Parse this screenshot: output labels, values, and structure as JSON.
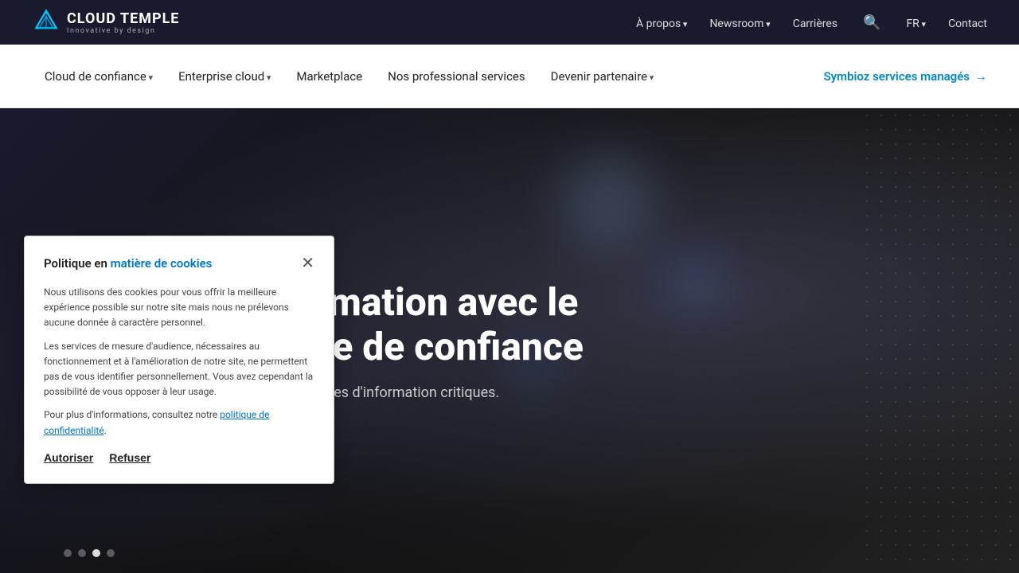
{
  "topnav": {
    "logo_text": "CLOUD TEMPLE",
    "logo_sub": "Innovative by design",
    "links": [
      {
        "label": "À propos",
        "has_arrow": true
      },
      {
        "label": "Newsroom",
        "has_arrow": true
      },
      {
        "label": "Carrières",
        "has_arrow": false
      },
      {
        "label": "FR",
        "has_arrow": true
      },
      {
        "label": "Contact",
        "has_arrow": false
      }
    ]
  },
  "secnav": {
    "links": [
      {
        "label": "Cloud de confiance",
        "has_arrow": true
      },
      {
        "label": "Enterprise cloud",
        "has_arrow": true
      },
      {
        "label": "Marketplace",
        "has_arrow": false
      },
      {
        "label": "Nos professional services",
        "has_arrow": false
      },
      {
        "label": "Devenir partenaire",
        "has_arrow": true
      }
    ],
    "cta_label": "Symbioz services managés"
  },
  "hero": {
    "title_line1": "re transformation avec le",
    "title_line2": "numérique de confiance",
    "subtitle": "n et sécurité pour vos systèmes d'information critiques."
  },
  "cookie": {
    "title_normal": "Politique en ",
    "title_highlight": "matière de cookies",
    "para1": "Nous utilisons des cookies pour vous offrir la meilleure expérience possible sur notre site mais nous ne prélevons aucune donnée à caractère personnel.",
    "para2": "Les services de mesure d'audience, nécessaires au fonctionnement et à l'amélioration de notre site, ne permettent pas de vous identifier personnellement. Vous avez cependant la possibilité de vous opposer à leur usage.",
    "para3_prefix": "Pour plus d'informations, consultez notre ",
    "para3_link": "politique de confidentialité",
    "para3_suffix": ".",
    "btn_authorize": "Autoriser",
    "btn_refuse": "Refuser"
  },
  "slider": {
    "dots": [
      false,
      false,
      true,
      false
    ]
  }
}
